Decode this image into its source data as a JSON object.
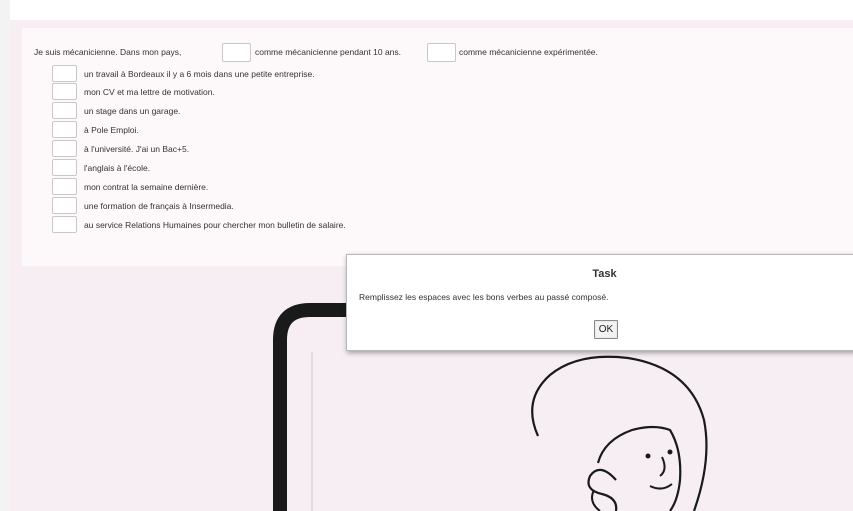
{
  "exercise": {
    "intro_part1": "Je suis mécanicienne. Dans mon pays,",
    "intro_part2": "comme mécanicienne pendant 10 ans.",
    "intro_part3": "comme mécanicienne expérimentée.",
    "lines": [
      "un travail à Bordeaux il y a 6 mois dans une petite entreprise.",
      "mon CV et ma lettre de motivation.",
      "un stage dans un garage.",
      "à Pole Emploi.",
      "à l'université. J'ai un Bac+5.",
      "l'anglais à l'école.",
      "mon contrat la semaine dernière.",
      "une formation de français à Insermedia.",
      "au service Relations Humaines pour chercher mon bulletin de salaire."
    ]
  },
  "dialog": {
    "title": "Task",
    "message": "Remplissez les espaces avec les bons verbes au passé composé.",
    "ok_label": "OK"
  },
  "colors": {
    "background": "#f6eef3",
    "panel": "#fdf8fa",
    "illustration_line": "#1a1a1a"
  },
  "icons": {
    "illustration": "woman-portrait-in-frame"
  }
}
